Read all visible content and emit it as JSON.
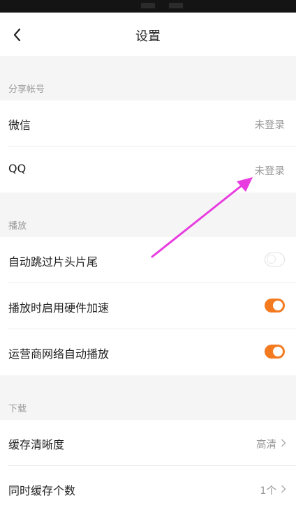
{
  "header": {
    "title": "设置"
  },
  "sections": [
    {
      "header": "分享帐号",
      "rows": [
        {
          "label": "微信",
          "value": "未登录"
        },
        {
          "label": "QQ",
          "value": "未登录"
        }
      ]
    },
    {
      "header": "播放",
      "rows": [
        {
          "label": "自动跳过片头片尾",
          "toggle": false
        },
        {
          "label": "播放时启用硬件加速",
          "toggle": true
        },
        {
          "label": "运营商网络自动播放",
          "toggle": true
        }
      ]
    },
    {
      "header": "下载",
      "rows": [
        {
          "label": "缓存清晰度",
          "value": "高清"
        },
        {
          "label": "同时缓存个数",
          "value": "1个"
        }
      ]
    }
  ],
  "colors": {
    "accent": "#f47a1f",
    "annotation_arrow": "#e83be0"
  },
  "icons": {
    "back": "chevron-left-icon",
    "row_arrow": "chevron-right-icon"
  }
}
